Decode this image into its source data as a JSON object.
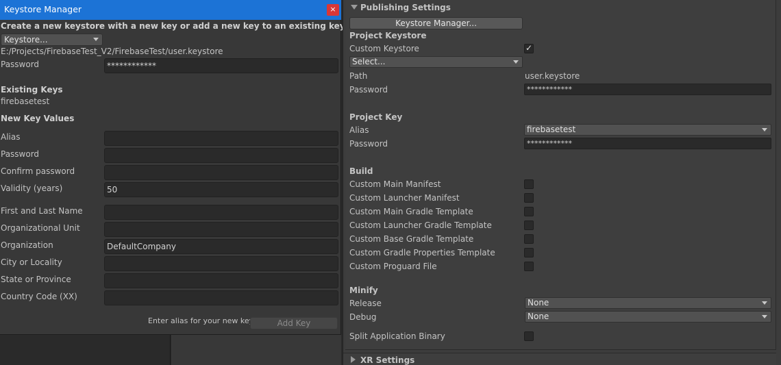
{
  "keystore_manager": {
    "title": "Keystore Manager",
    "close_glyph": "×",
    "heading": "Create a new keystore with a new key or add a new key to an existing keystore",
    "keystore_dropdown": "Keystore...",
    "keystore_path": "E:/Projects/FirebaseTest_V2/FirebaseTest/user.keystore",
    "password_label": "Password",
    "password_value": "************",
    "existing_keys_heading": "Existing Keys",
    "existing_keys": [
      "firebasetest"
    ],
    "new_key_heading": "New Key Values",
    "fields": [
      {
        "label": "Alias",
        "value": ""
      },
      {
        "label": "Password",
        "value": ""
      },
      {
        "label": "Confirm password",
        "value": ""
      },
      {
        "label": "Validity (years)",
        "value": "50"
      },
      {
        "label": "First and Last Name",
        "value": ""
      },
      {
        "label": "Organizational Unit",
        "value": ""
      },
      {
        "label": "Organization",
        "value": "DefaultCompany"
      },
      {
        "label": "City or Locality",
        "value": ""
      },
      {
        "label": "State or Province",
        "value": ""
      },
      {
        "label": "Country Code (XX)",
        "value": ""
      }
    ],
    "hint": "Enter alias for your new key.",
    "add_key_button": "Add Key"
  },
  "publishing": {
    "foldout_title": "Publishing Settings",
    "keystore_manager_button": "Keystore Manager...",
    "project_keystore_heading": "Project Keystore",
    "custom_keystore_label": "Custom Keystore",
    "custom_keystore_checked": true,
    "select_dropdown": "Select...",
    "path_label": "Path",
    "path_value": "user.keystore",
    "keystore_password_label": "Password",
    "keystore_password_value": "************",
    "project_key_heading": "Project Key",
    "alias_label": "Alias",
    "alias_value": "firebasetest",
    "key_password_label": "Password",
    "key_password_value": "************",
    "build_heading": "Build",
    "build_options": [
      {
        "label": "Custom Main Manifest",
        "checked": false
      },
      {
        "label": "Custom Launcher Manifest",
        "checked": false
      },
      {
        "label": "Custom Main Gradle Template",
        "checked": false
      },
      {
        "label": "Custom Launcher Gradle Template",
        "checked": false
      },
      {
        "label": "Custom Base Gradle Template",
        "checked": false
      },
      {
        "label": "Custom Gradle Properties Template",
        "checked": false
      },
      {
        "label": "Custom Proguard File",
        "checked": false
      }
    ],
    "minify_heading": "Minify",
    "release_label": "Release",
    "release_value": "None",
    "debug_label": "Debug",
    "debug_value": "None",
    "split_binary_label": "Split Application Binary",
    "split_binary_checked": false,
    "xr_settings_title": "XR Settings"
  }
}
